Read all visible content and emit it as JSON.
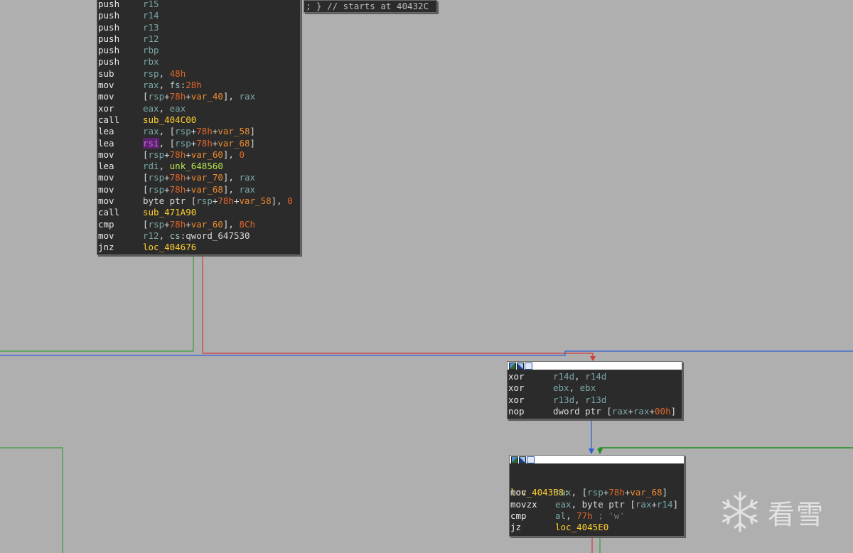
{
  "top_comment": "; } // starts at 40432C",
  "block_main": {
    "lines": [
      {
        "mn": "push",
        "ops": [
          {
            "t": "r15",
            "c": "reg"
          }
        ]
      },
      {
        "mn": "push",
        "ops": [
          {
            "t": "r14",
            "c": "reg"
          }
        ]
      },
      {
        "mn": "push",
        "ops": [
          {
            "t": "r13",
            "c": "reg"
          }
        ]
      },
      {
        "mn": "push",
        "ops": [
          {
            "t": "r12",
            "c": "reg"
          }
        ]
      },
      {
        "mn": "push",
        "ops": [
          {
            "t": "rbp",
            "c": "reg"
          }
        ]
      },
      {
        "mn": "push",
        "ops": [
          {
            "t": "rbx",
            "c": "reg"
          }
        ]
      },
      {
        "mn": "sub",
        "ops": [
          {
            "t": "rsp",
            "c": "reg"
          },
          {
            "t": ", ",
            "c": "txt"
          },
          {
            "t": "48h",
            "c": "num"
          }
        ]
      },
      {
        "mn": "mov",
        "ops": [
          {
            "t": "rax",
            "c": "reg"
          },
          {
            "t": ", ",
            "c": "txt"
          },
          {
            "t": "fs",
            "c": "seg"
          },
          {
            "t": ":",
            "c": "txt"
          },
          {
            "t": "28h",
            "c": "num"
          }
        ]
      },
      {
        "mn": "mov",
        "ops": [
          {
            "t": "[",
            "c": "txt"
          },
          {
            "t": "rsp",
            "c": "reg"
          },
          {
            "t": "+",
            "c": "txt"
          },
          {
            "t": "78h",
            "c": "num"
          },
          {
            "t": "+",
            "c": "txt"
          },
          {
            "t": "var_40",
            "c": "var"
          },
          {
            "t": "], ",
            "c": "txt"
          },
          {
            "t": "rax",
            "c": "reg"
          }
        ]
      },
      {
        "mn": "xor",
        "ops": [
          {
            "t": "eax",
            "c": "reg"
          },
          {
            "t": ", ",
            "c": "txt"
          },
          {
            "t": "eax",
            "c": "reg"
          }
        ]
      },
      {
        "mn": "call",
        "ops": [
          {
            "t": "sub_404C00",
            "c": "sym"
          }
        ]
      },
      {
        "mn": "lea",
        "ops": [
          {
            "t": "rax",
            "c": "reg"
          },
          {
            "t": ", [",
            "c": "txt"
          },
          {
            "t": "rsp",
            "c": "reg"
          },
          {
            "t": "+",
            "c": "txt"
          },
          {
            "t": "78h",
            "c": "num"
          },
          {
            "t": "+",
            "c": "txt"
          },
          {
            "t": "var_58",
            "c": "var"
          },
          {
            "t": "]",
            "c": "txt"
          }
        ]
      },
      {
        "mn": "lea",
        "ops": [
          {
            "t": "rsi",
            "c": "hl"
          },
          {
            "t": ", [",
            "c": "txt"
          },
          {
            "t": "rsp",
            "c": "reg"
          },
          {
            "t": "+",
            "c": "txt"
          },
          {
            "t": "78h",
            "c": "num"
          },
          {
            "t": "+",
            "c": "txt"
          },
          {
            "t": "var_68",
            "c": "var"
          },
          {
            "t": "]",
            "c": "txt"
          }
        ]
      },
      {
        "mn": "mov",
        "ops": [
          {
            "t": "[",
            "c": "txt"
          },
          {
            "t": "rsp",
            "c": "reg"
          },
          {
            "t": "+",
            "c": "txt"
          },
          {
            "t": "78h",
            "c": "num"
          },
          {
            "t": "+",
            "c": "txt"
          },
          {
            "t": "var_60",
            "c": "var"
          },
          {
            "t": "], ",
            "c": "txt"
          },
          {
            "t": "0",
            "c": "num"
          }
        ]
      },
      {
        "mn": "lea",
        "ops": [
          {
            "t": "rdi",
            "c": "reg"
          },
          {
            "t": ", ",
            "c": "txt"
          },
          {
            "t": "unk_648560",
            "c": "dat"
          }
        ]
      },
      {
        "mn": "mov",
        "ops": [
          {
            "t": "[",
            "c": "txt"
          },
          {
            "t": "rsp",
            "c": "reg"
          },
          {
            "t": "+",
            "c": "txt"
          },
          {
            "t": "78h",
            "c": "num"
          },
          {
            "t": "+",
            "c": "txt"
          },
          {
            "t": "var_70",
            "c": "var"
          },
          {
            "t": "], ",
            "c": "txt"
          },
          {
            "t": "rax",
            "c": "reg"
          }
        ]
      },
      {
        "mn": "mov",
        "ops": [
          {
            "t": "[",
            "c": "txt"
          },
          {
            "t": "rsp",
            "c": "reg"
          },
          {
            "t": "+",
            "c": "txt"
          },
          {
            "t": "78h",
            "c": "num"
          },
          {
            "t": "+",
            "c": "txt"
          },
          {
            "t": "var_68",
            "c": "var"
          },
          {
            "t": "], ",
            "c": "txt"
          },
          {
            "t": "rax",
            "c": "reg"
          }
        ]
      },
      {
        "mn": "mov",
        "ops": [
          {
            "t": "byte ptr [",
            "c": "txt"
          },
          {
            "t": "rsp",
            "c": "reg"
          },
          {
            "t": "+",
            "c": "txt"
          },
          {
            "t": "78h",
            "c": "num"
          },
          {
            "t": "+",
            "c": "txt"
          },
          {
            "t": "var_58",
            "c": "var"
          },
          {
            "t": "], ",
            "c": "txt"
          },
          {
            "t": "0",
            "c": "num"
          }
        ]
      },
      {
        "mn": "call",
        "ops": [
          {
            "t": "sub_471A90",
            "c": "sym"
          }
        ]
      },
      {
        "mn": "cmp",
        "ops": [
          {
            "t": "[",
            "c": "txt"
          },
          {
            "t": "rsp",
            "c": "reg"
          },
          {
            "t": "+",
            "c": "txt"
          },
          {
            "t": "78h",
            "c": "num"
          },
          {
            "t": "+",
            "c": "txt"
          },
          {
            "t": "var_60",
            "c": "var"
          },
          {
            "t": "], ",
            "c": "txt"
          },
          {
            "t": "8Ch",
            "c": "num"
          }
        ]
      },
      {
        "mn": "mov",
        "ops": [
          {
            "t": "r12",
            "c": "reg"
          },
          {
            "t": ", ",
            "c": "txt"
          },
          {
            "t": "cs",
            "c": "seg"
          },
          {
            "t": ":",
            "c": "txt"
          },
          {
            "t": "qword_647530",
            "c": "txt"
          }
        ]
      },
      {
        "mn": "jnz",
        "ops": [
          {
            "t": "loc_404676",
            "c": "sym"
          }
        ]
      }
    ]
  },
  "block_init": {
    "lines": [
      {
        "mn": "xor",
        "ops": [
          {
            "t": "r14d",
            "c": "reg"
          },
          {
            "t": ", ",
            "c": "txt"
          },
          {
            "t": "r14d",
            "c": "reg"
          }
        ]
      },
      {
        "mn": "xor",
        "ops": [
          {
            "t": "ebx",
            "c": "reg"
          },
          {
            "t": ", ",
            "c": "txt"
          },
          {
            "t": "ebx",
            "c": "reg"
          }
        ]
      },
      {
        "mn": "xor",
        "ops": [
          {
            "t": "r13d",
            "c": "reg"
          },
          {
            "t": ", ",
            "c": "txt"
          },
          {
            "t": "r13d",
            "c": "reg"
          }
        ]
      },
      {
        "mn": "nop",
        "ops": [
          {
            "t": "dword ptr [",
            "c": "txt"
          },
          {
            "t": "rax",
            "c": "reg"
          },
          {
            "t": "+",
            "c": "txt"
          },
          {
            "t": "rax",
            "c": "reg"
          },
          {
            "t": "+",
            "c": "txt"
          },
          {
            "t": "00h",
            "c": "num"
          },
          {
            "t": "]",
            "c": "txt"
          }
        ]
      }
    ]
  },
  "block_loop": {
    "label": "loc_4043B8:",
    "lines": [
      {
        "mn": "mov",
        "ops": [
          {
            "t": "rax",
            "c": "reg"
          },
          {
            "t": ", [",
            "c": "txt"
          },
          {
            "t": "rsp",
            "c": "reg"
          },
          {
            "t": "+",
            "c": "txt"
          },
          {
            "t": "78h",
            "c": "num"
          },
          {
            "t": "+",
            "c": "txt"
          },
          {
            "t": "var_68",
            "c": "var"
          },
          {
            "t": "]",
            "c": "txt"
          }
        ]
      },
      {
        "mn": "movzx",
        "ops": [
          {
            "t": "eax",
            "c": "reg"
          },
          {
            "t": ", byte ptr [",
            "c": "txt"
          },
          {
            "t": "rax",
            "c": "reg"
          },
          {
            "t": "+",
            "c": "txt"
          },
          {
            "t": "r14",
            "c": "reg"
          },
          {
            "t": "]",
            "c": "txt"
          }
        ]
      },
      {
        "mn": "cmp",
        "ops": [
          {
            "t": "al",
            "c": "reg"
          },
          {
            "t": ", ",
            "c": "txt"
          },
          {
            "t": "77h",
            "c": "num"
          },
          {
            "t": " ; 'w'",
            "c": "cmt"
          }
        ]
      },
      {
        "mn": "jz",
        "ops": [
          {
            "t": "loc_4045E0",
            "c": "sym"
          }
        ]
      }
    ]
  },
  "watermark": {
    "text": "看雪",
    "icon": "snowflake-icon"
  },
  "colors": {
    "background": "#afafaf",
    "edge_true": "#3d9b3d",
    "edge_false": "#d33a3a",
    "edge_uncond": "#2f5fd0"
  }
}
